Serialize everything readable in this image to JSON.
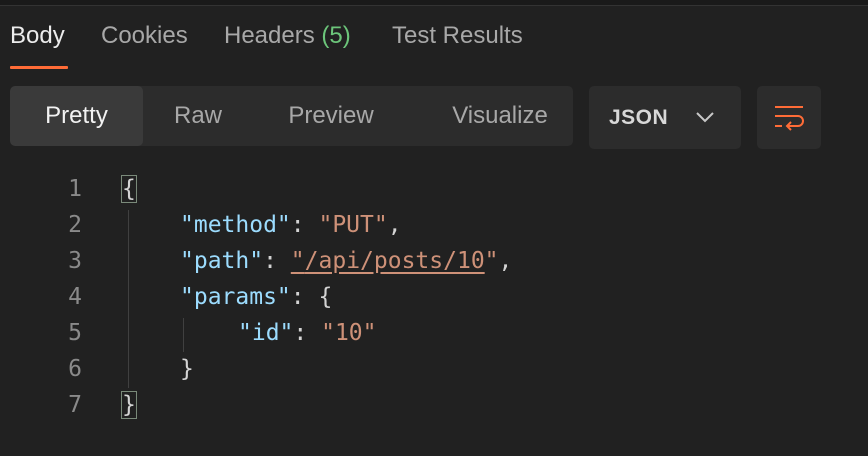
{
  "tabs": {
    "body": "Body",
    "cookies": "Cookies",
    "headers": "Headers",
    "headers_count": "(5)",
    "test_results": "Test Results"
  },
  "view_modes": {
    "pretty": "Pretty",
    "raw": "Raw",
    "preview": "Preview",
    "visualize": "Visualize"
  },
  "format_dropdown": {
    "selected": "JSON",
    "icon": "chevron-down-icon"
  },
  "wrap_button": {
    "icon": "wrap-lines-icon"
  },
  "colors": {
    "accent": "#ff6c37",
    "count": "#6cc57a",
    "key": "#9cdcfe",
    "string": "#ce9178"
  },
  "code": {
    "line_numbers": [
      "1",
      "2",
      "3",
      "4",
      "5",
      "6",
      "7"
    ],
    "open_brace": "{",
    "close_brace": "}",
    "method_key": "\"method\"",
    "method_value": "\"PUT\"",
    "path_key": "\"path\"",
    "path_quote_open": "\"",
    "path_value": "/api/posts/10",
    "path_quote_close": "\"",
    "params_key": "\"params\"",
    "id_key": "\"id\"",
    "id_value": "\"10\""
  }
}
